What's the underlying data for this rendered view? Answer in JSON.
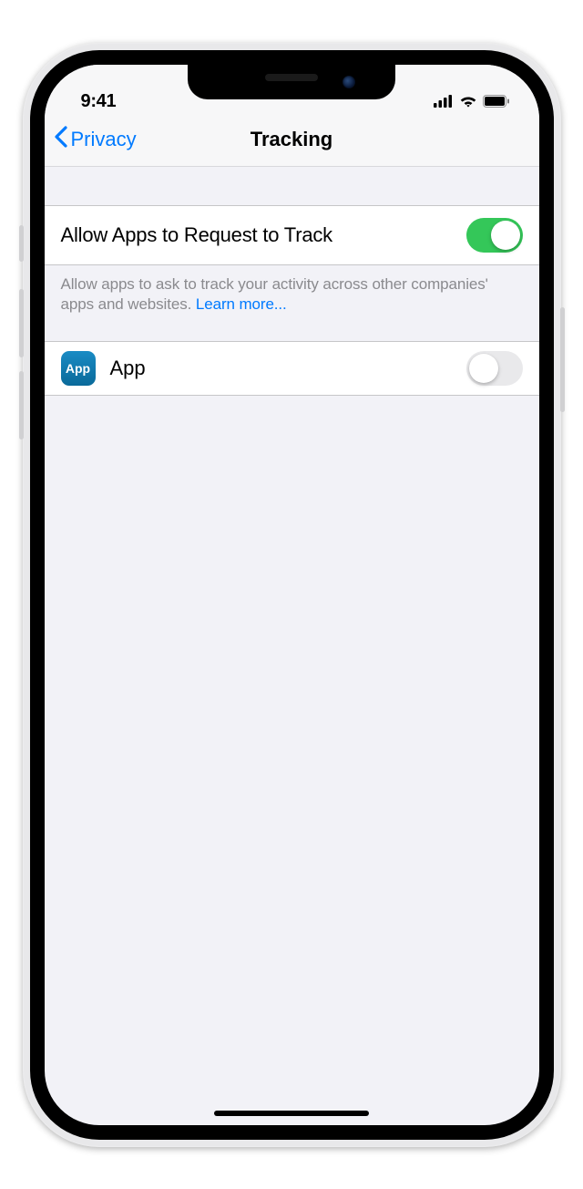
{
  "status": {
    "time": "9:41"
  },
  "nav": {
    "back_label": "Privacy",
    "title": "Tracking"
  },
  "main_toggle": {
    "label": "Allow Apps to Request to Track",
    "on": true
  },
  "footer": {
    "text": "Allow apps to ask to track your activity across other companies' apps and websites. ",
    "learn_more": "Learn more..."
  },
  "app_row": {
    "icon_text": "App",
    "name": "App",
    "on": false
  }
}
